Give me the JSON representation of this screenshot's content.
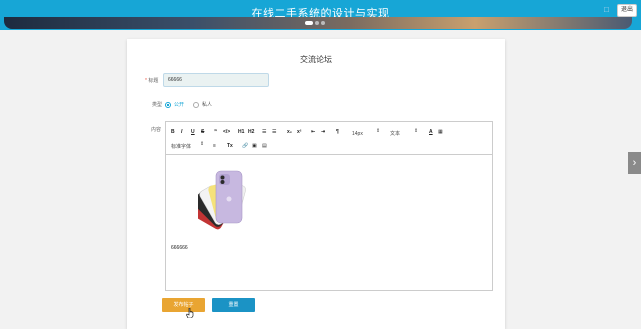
{
  "header": {
    "title": "在线二手系统的设计与实现",
    "minimize_glyph": "□",
    "exit_label": "退出"
  },
  "banner": {
    "active_slide": 1,
    "slide_count": 3
  },
  "form": {
    "heading": "交流论坛",
    "title_label_mark": "*",
    "title_label": "标题",
    "title_value": "66666",
    "type_label": "类型",
    "type_options": [
      "公开",
      "私人"
    ],
    "type_selected": "公开",
    "content_label": "内容",
    "content_text": "666666",
    "content_image": "purple-iphone-color-fan",
    "post_button": "发布帖子",
    "reset_button": "重置"
  },
  "toolbar": {
    "row1": [
      "B",
      "I",
      "U",
      "S",
      "❞",
      "</>",
      "H1",
      "H2",
      "☰",
      "☰",
      "x₂",
      "x²",
      "⇤",
      "⇥",
      "¶"
    ],
    "size_select": "14px",
    "text_select": "文本",
    "color_icons": [
      "A",
      "▦"
    ],
    "font_select": "标准字体",
    "row2": [
      "≡",
      "Tx",
      "🔗",
      "▣",
      "▤"
    ]
  },
  "side_nav": {
    "glyph": "›"
  },
  "colors": {
    "header_bg": "#17a6d6",
    "post_button": "#e9a532",
    "reset_button": "#1b93c5",
    "radio_active": "#17a6d6"
  }
}
